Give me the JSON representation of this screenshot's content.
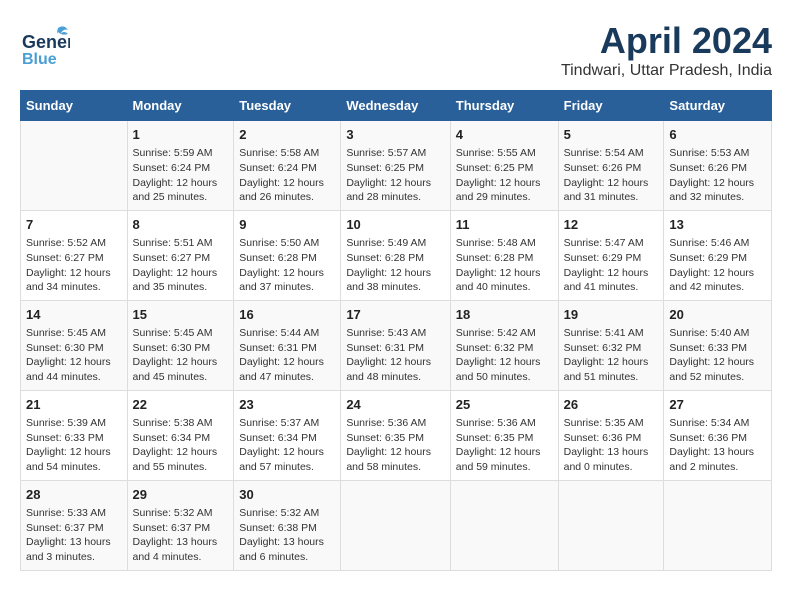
{
  "header": {
    "logo_line1": "General",
    "logo_line2": "Blue",
    "title": "April 2024",
    "subtitle": "Tindwari, Uttar Pradesh, India"
  },
  "weekdays": [
    "Sunday",
    "Monday",
    "Tuesday",
    "Wednesday",
    "Thursday",
    "Friday",
    "Saturday"
  ],
  "weeks": [
    [
      {
        "day": "",
        "info": ""
      },
      {
        "day": "1",
        "info": "Sunrise: 5:59 AM\nSunset: 6:24 PM\nDaylight: 12 hours\nand 25 minutes."
      },
      {
        "day": "2",
        "info": "Sunrise: 5:58 AM\nSunset: 6:24 PM\nDaylight: 12 hours\nand 26 minutes."
      },
      {
        "day": "3",
        "info": "Sunrise: 5:57 AM\nSunset: 6:25 PM\nDaylight: 12 hours\nand 28 minutes."
      },
      {
        "day": "4",
        "info": "Sunrise: 5:55 AM\nSunset: 6:25 PM\nDaylight: 12 hours\nand 29 minutes."
      },
      {
        "day": "5",
        "info": "Sunrise: 5:54 AM\nSunset: 6:26 PM\nDaylight: 12 hours\nand 31 minutes."
      },
      {
        "day": "6",
        "info": "Sunrise: 5:53 AM\nSunset: 6:26 PM\nDaylight: 12 hours\nand 32 minutes."
      }
    ],
    [
      {
        "day": "7",
        "info": "Sunrise: 5:52 AM\nSunset: 6:27 PM\nDaylight: 12 hours\nand 34 minutes."
      },
      {
        "day": "8",
        "info": "Sunrise: 5:51 AM\nSunset: 6:27 PM\nDaylight: 12 hours\nand 35 minutes."
      },
      {
        "day": "9",
        "info": "Sunrise: 5:50 AM\nSunset: 6:28 PM\nDaylight: 12 hours\nand 37 minutes."
      },
      {
        "day": "10",
        "info": "Sunrise: 5:49 AM\nSunset: 6:28 PM\nDaylight: 12 hours\nand 38 minutes."
      },
      {
        "day": "11",
        "info": "Sunrise: 5:48 AM\nSunset: 6:28 PM\nDaylight: 12 hours\nand 40 minutes."
      },
      {
        "day": "12",
        "info": "Sunrise: 5:47 AM\nSunset: 6:29 PM\nDaylight: 12 hours\nand 41 minutes."
      },
      {
        "day": "13",
        "info": "Sunrise: 5:46 AM\nSunset: 6:29 PM\nDaylight: 12 hours\nand 42 minutes."
      }
    ],
    [
      {
        "day": "14",
        "info": "Sunrise: 5:45 AM\nSunset: 6:30 PM\nDaylight: 12 hours\nand 44 minutes."
      },
      {
        "day": "15",
        "info": "Sunrise: 5:45 AM\nSunset: 6:30 PM\nDaylight: 12 hours\nand 45 minutes."
      },
      {
        "day": "16",
        "info": "Sunrise: 5:44 AM\nSunset: 6:31 PM\nDaylight: 12 hours\nand 47 minutes."
      },
      {
        "day": "17",
        "info": "Sunrise: 5:43 AM\nSunset: 6:31 PM\nDaylight: 12 hours\nand 48 minutes."
      },
      {
        "day": "18",
        "info": "Sunrise: 5:42 AM\nSunset: 6:32 PM\nDaylight: 12 hours\nand 50 minutes."
      },
      {
        "day": "19",
        "info": "Sunrise: 5:41 AM\nSunset: 6:32 PM\nDaylight: 12 hours\nand 51 minutes."
      },
      {
        "day": "20",
        "info": "Sunrise: 5:40 AM\nSunset: 6:33 PM\nDaylight: 12 hours\nand 52 minutes."
      }
    ],
    [
      {
        "day": "21",
        "info": "Sunrise: 5:39 AM\nSunset: 6:33 PM\nDaylight: 12 hours\nand 54 minutes."
      },
      {
        "day": "22",
        "info": "Sunrise: 5:38 AM\nSunset: 6:34 PM\nDaylight: 12 hours\nand 55 minutes."
      },
      {
        "day": "23",
        "info": "Sunrise: 5:37 AM\nSunset: 6:34 PM\nDaylight: 12 hours\nand 57 minutes."
      },
      {
        "day": "24",
        "info": "Sunrise: 5:36 AM\nSunset: 6:35 PM\nDaylight: 12 hours\nand 58 minutes."
      },
      {
        "day": "25",
        "info": "Sunrise: 5:36 AM\nSunset: 6:35 PM\nDaylight: 12 hours\nand 59 minutes."
      },
      {
        "day": "26",
        "info": "Sunrise: 5:35 AM\nSunset: 6:36 PM\nDaylight: 13 hours\nand 0 minutes."
      },
      {
        "day": "27",
        "info": "Sunrise: 5:34 AM\nSunset: 6:36 PM\nDaylight: 13 hours\nand 2 minutes."
      }
    ],
    [
      {
        "day": "28",
        "info": "Sunrise: 5:33 AM\nSunset: 6:37 PM\nDaylight: 13 hours\nand 3 minutes."
      },
      {
        "day": "29",
        "info": "Sunrise: 5:32 AM\nSunset: 6:37 PM\nDaylight: 13 hours\nand 4 minutes."
      },
      {
        "day": "30",
        "info": "Sunrise: 5:32 AM\nSunset: 6:38 PM\nDaylight: 13 hours\nand 6 minutes."
      },
      {
        "day": "",
        "info": ""
      },
      {
        "day": "",
        "info": ""
      },
      {
        "day": "",
        "info": ""
      },
      {
        "day": "",
        "info": ""
      }
    ]
  ]
}
